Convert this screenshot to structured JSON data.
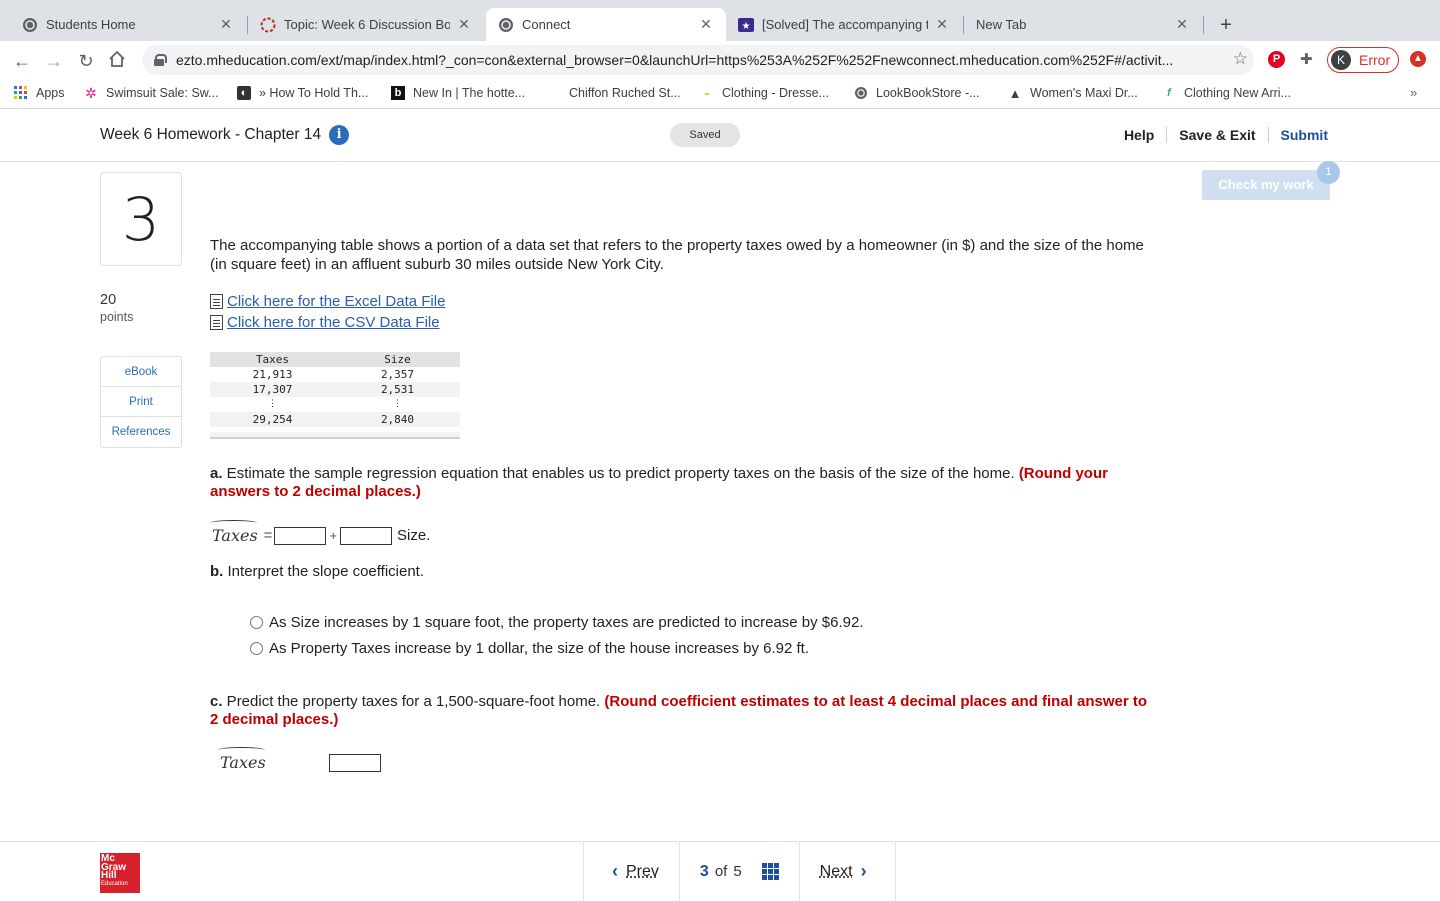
{
  "browser": {
    "tabs": [
      {
        "label": "Students Home"
      },
      {
        "label": "Topic: Week 6 Discussion Boar"
      },
      {
        "label": "Connect"
      },
      {
        "label": "[Solved] The accompanying ta"
      },
      {
        "label": "New Tab"
      }
    ],
    "url": "ezto.mheducation.com/ext/map/index.html?_con=con&external_browser=0&launchUrl=https%253A%252F%252Fnewconnect.mheducation.com%252F#/activit...",
    "profile_initial": "K",
    "profile_status": "Error",
    "bookmarks": [
      {
        "label": "Apps"
      },
      {
        "label": "Swimsuit Sale: Sw..."
      },
      {
        "label": "» How To Hold Th..."
      },
      {
        "label": "New In | The hotte..."
      },
      {
        "label": "Chiffon Ruched St..."
      },
      {
        "label": "Clothing - Dresse..."
      },
      {
        "label": "LookBookStore -..."
      },
      {
        "label": "Women's Maxi Dr..."
      },
      {
        "label": "Clothing New Arri..."
      }
    ]
  },
  "header": {
    "title": "Week 6 Homework - Chapter 14",
    "saved": "Saved",
    "help": "Help",
    "save_exit": "Save & Exit",
    "submit": "Submit"
  },
  "question": {
    "number": "3",
    "points_value": "20",
    "points_label": "points",
    "resources": [
      "eBook",
      "Print",
      "References"
    ],
    "check_work": "Check my work",
    "check_badge": "1",
    "intro": "The accompanying table shows a portion of a data set that refers to the property taxes owed by a homeowner (in $) and the size of the home (in square feet) in an affluent suburb 30 miles outside New York City.",
    "excel_link": "Click here for the Excel Data File",
    "csv_link": "Click here for the CSV Data File",
    "table": {
      "headers": [
        "Taxes",
        "Size"
      ],
      "rows": [
        [
          "21,913",
          "2,357"
        ],
        [
          "17,307",
          "2,531"
        ],
        [
          "⋮",
          "⋮"
        ],
        [
          "29,254",
          "2,840"
        ]
      ]
    },
    "part_a": {
      "label": "a.",
      "text": " Estimate the sample regression equation that enables us to predict property taxes on the basis of the size of the home. ",
      "note": "(Round your answers to 2 decimal places.)",
      "var": "Taxes",
      "equals": "=",
      "plus": "+",
      "size": "Size."
    },
    "part_b": {
      "label": "b.",
      "text": " Interpret the slope coefficient.",
      "options": [
        "As Size increases by 1 square foot, the property taxes are predicted to increase by $6.92.",
        "As Property Taxes increase by 1 dollar, the size of the house increases by 6.92 ft."
      ]
    },
    "part_c": {
      "label": "c.",
      "text": " Predict the property taxes for a 1,500-square-foot home. ",
      "note": "(Round coefficient estimates to at least 4 decimal places and final answer to 2 decimal places.)",
      "var": "Taxes"
    }
  },
  "footer": {
    "logo_line1": "Mc",
    "logo_line2": "Graw",
    "logo_line3": "Hill",
    "logo_line4": "Education",
    "prev": "Prev",
    "current": "3",
    "of": "of",
    "total": "5",
    "next": "Next"
  },
  "colors": {
    "accent": "#1f4e9c",
    "link": "#2a5db0",
    "note_red": "#c00000",
    "check_work_bg": "#cfdff0"
  }
}
